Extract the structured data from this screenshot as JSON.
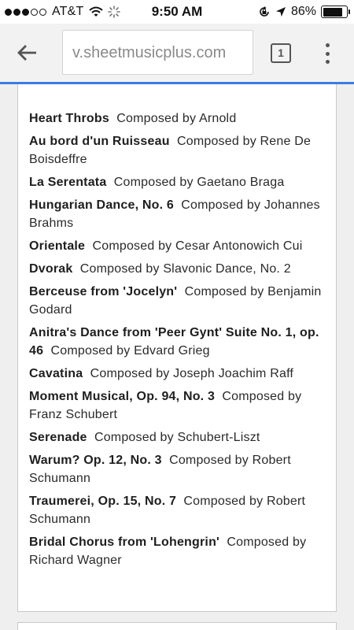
{
  "status_bar": {
    "carrier": "AT&T",
    "time": "9:50 AM",
    "battery_percent": "86%",
    "signal_bars_filled": 3,
    "signal_bars_total": 5
  },
  "browser": {
    "url_text": "v.sheetmusicplus.com",
    "tab_count": "1",
    "page_load_progress": 1.0,
    "accent_color": "#3a7de0"
  },
  "pieces": [
    {
      "title": "Heart Throbs",
      "composer": "Composed by Arnold"
    },
    {
      "title": "Au bord d'un Ruisseau",
      "composer": "Composed by Rene De Boisdeffre"
    },
    {
      "title": "La Serentata",
      "composer": "Composed by Gaetano Braga"
    },
    {
      "title": "Hungarian Dance, No. 6",
      "composer": "Composed by Johannes Brahms"
    },
    {
      "title": "Orientale",
      "composer": "Composed by Cesar Antonowich Cui"
    },
    {
      "title": "Dvorak",
      "composer": "Composed by Slavonic Dance, No. 2"
    },
    {
      "title": "Berceuse from 'Jocelyn'",
      "composer": "Composed by Benjamin Godard"
    },
    {
      "title": "Anitra's Dance from 'Peer Gynt' Suite No. 1, op. 46",
      "composer": "Composed by Edvard Grieg"
    },
    {
      "title": "Cavatina",
      "composer": "Composed by Joseph Joachim Raff"
    },
    {
      "title": "Moment Musical, Op. 94, No. 3",
      "composer": "Composed by Franz Schubert"
    },
    {
      "title": "Serenade",
      "composer": "Composed by Schubert-Liszt"
    },
    {
      "title": "Warum? Op. 12, No. 3",
      "composer": "Composed by Robert Schumann"
    },
    {
      "title": "Traumerei, Op. 15, No. 7",
      "composer": "Composed by Robert Schumann"
    },
    {
      "title": "Bridal Chorus from 'Lohengrin'",
      "composer": "Composed by Richard Wagner"
    }
  ],
  "icons": {
    "back": "arrow-left-icon",
    "menu": "more-vert-icon",
    "wifi": "wifi-icon",
    "loading": "activity-spinner-icon",
    "lock_rotation": "rotation-lock-icon",
    "location": "location-arrow-icon",
    "battery": "battery-icon"
  }
}
